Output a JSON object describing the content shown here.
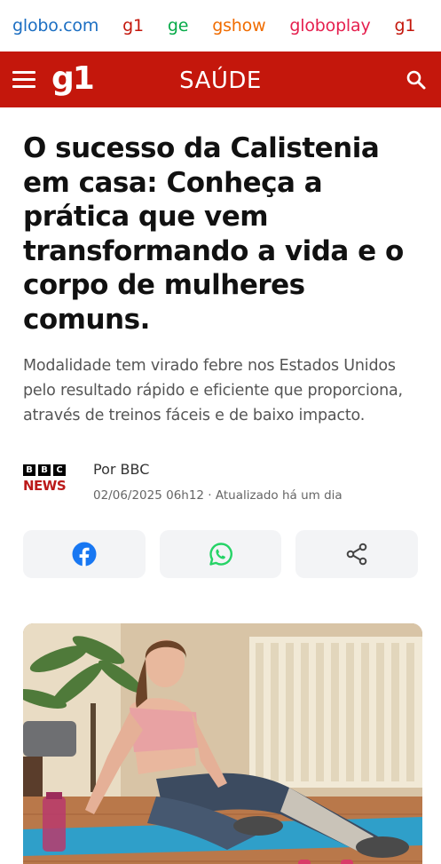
{
  "topnav": {
    "links": [
      "globo.com",
      "g1",
      "ge",
      "gshow",
      "globoplay",
      "g1"
    ]
  },
  "header": {
    "logo": "g1",
    "section": "SAÚDE"
  },
  "article": {
    "headline": "O sucesso da Calistenia em casa: Conheça a prática que vem transformando a vida e o corpo de mulheres comuns.",
    "subtitle": "Modalidade tem virado febre nos Estados Unidos pelo resultado rápido e eficiente que proporciona, através de treinos fáceis e de baixo impacto.",
    "source_logo": {
      "blocks": [
        "B",
        "B",
        "C"
      ],
      "news": "NEWS"
    },
    "author": "Por BBC",
    "date": "02/06/2025 06h12 · Atualizado há um dia"
  },
  "share": {
    "icons": [
      "facebook-icon",
      "whatsapp-icon",
      "share-icon"
    ]
  },
  "colors": {
    "brand_red": "#c4170c",
    "facebook": "#1877f2",
    "whatsapp": "#25d366"
  }
}
